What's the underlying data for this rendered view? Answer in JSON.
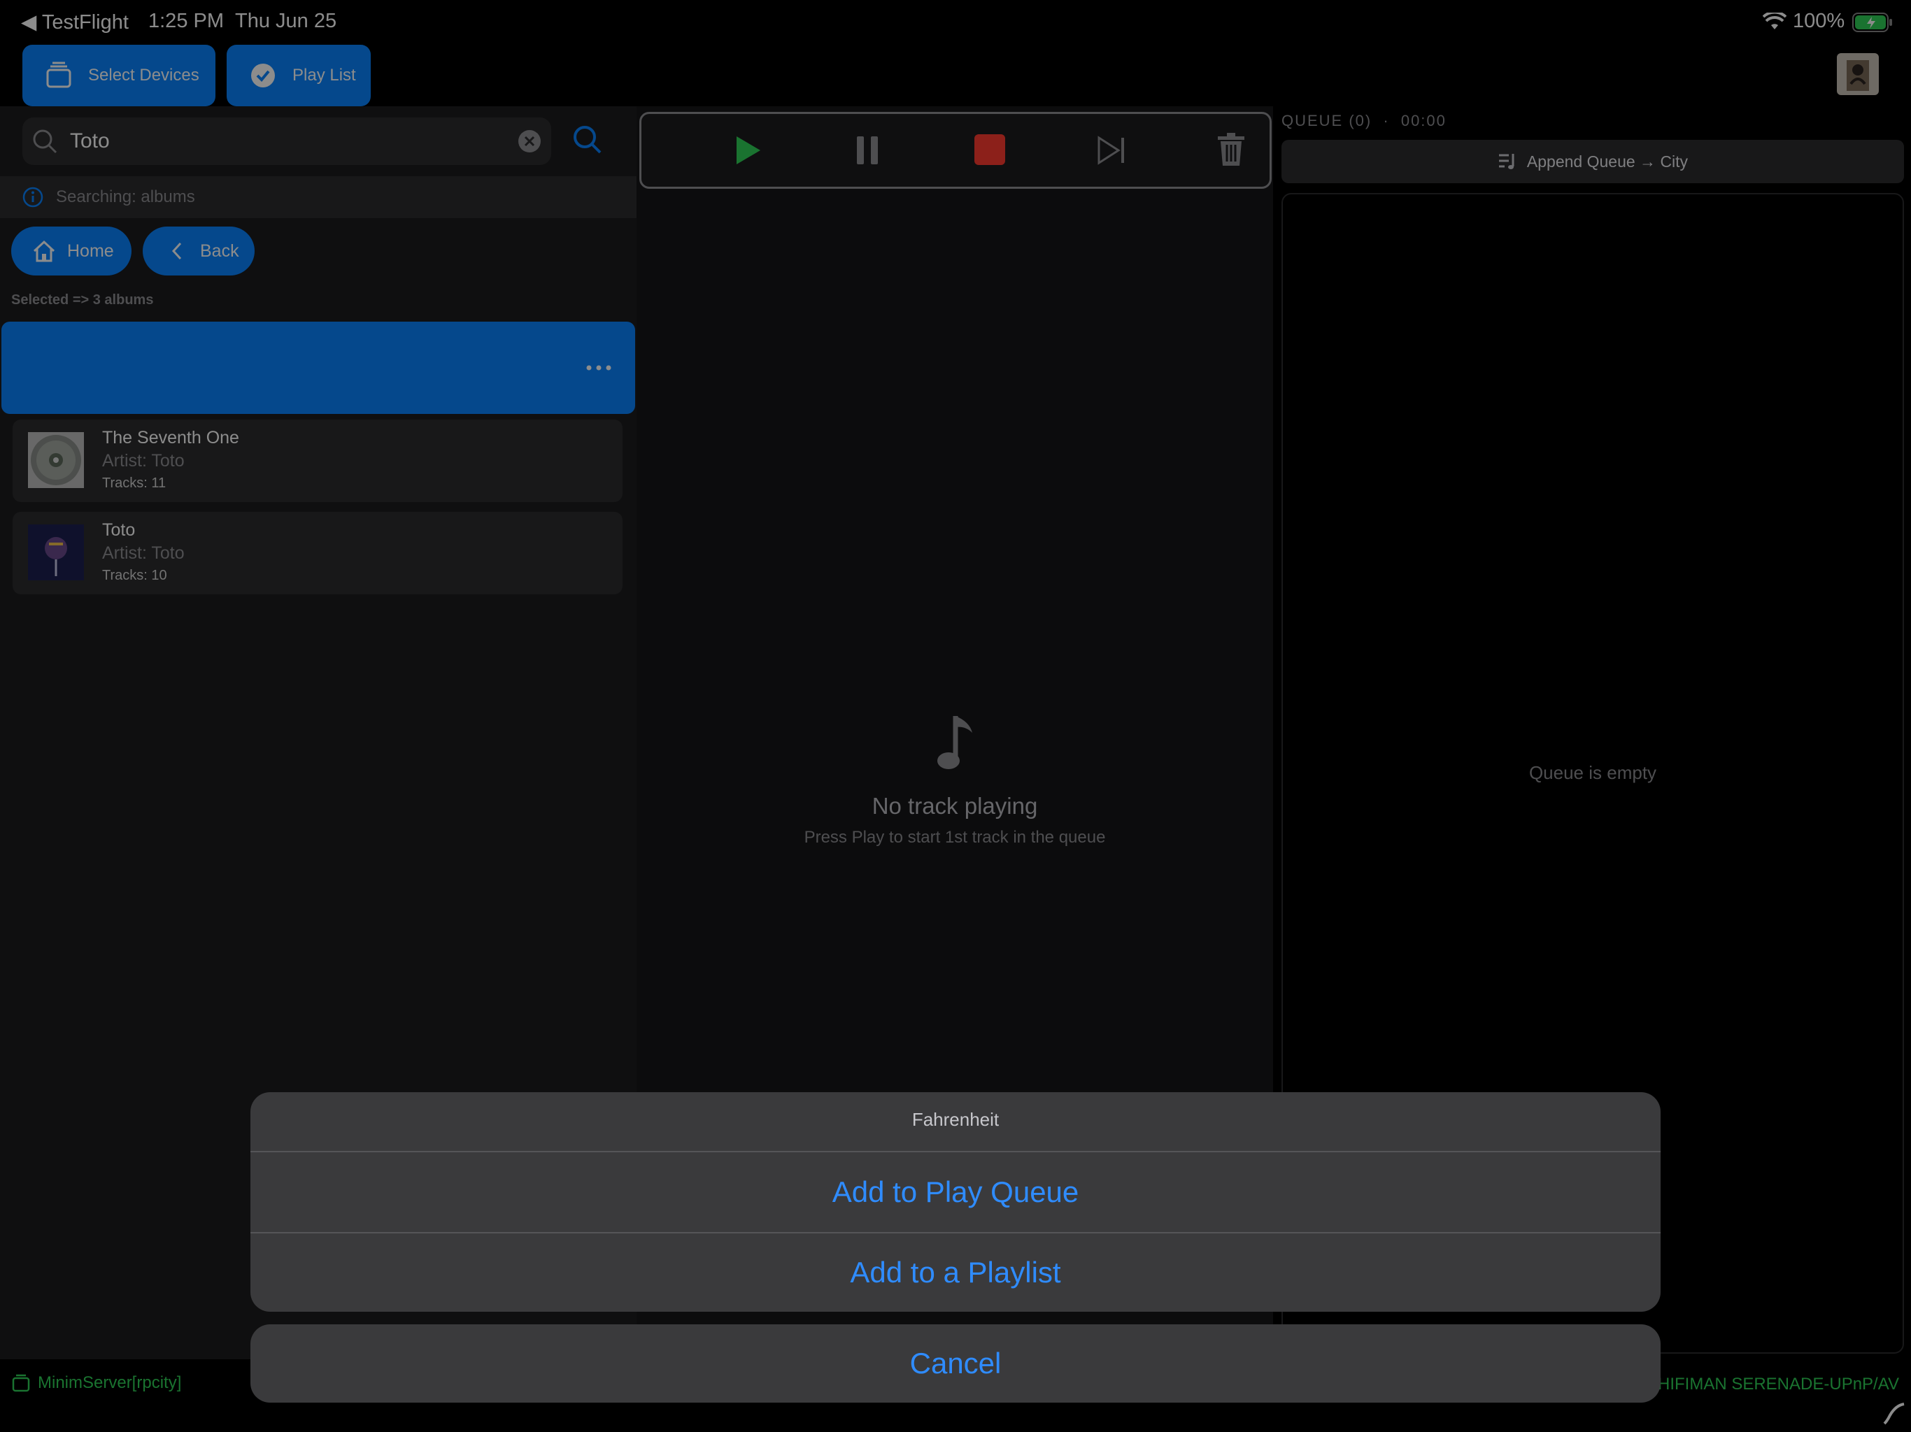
{
  "status_bar": {
    "back_app": "TestFlight",
    "time": "1:25 PM",
    "date": "Thu Jun 25",
    "battery": "100%"
  },
  "toolbar": {
    "select_devices": "Select Devices",
    "play_list": "Play List"
  },
  "search": {
    "value": "Toto",
    "info": "Searching: albums"
  },
  "nav": {
    "home": "Home",
    "back": "Back"
  },
  "selection_label": "Selected => 3 albums",
  "albums": [
    {
      "title": "",
      "artist": "",
      "tracks": "",
      "selected": true
    },
    {
      "title": "The Seventh One",
      "artist": "Artist: Toto",
      "tracks": "Tracks: 11"
    },
    {
      "title": "Toto",
      "artist": "Artist: Toto",
      "tracks": "Tracks: 10"
    }
  ],
  "player": {
    "no_track": "No track playing",
    "hint": "Press Play to start 1st track in the queue"
  },
  "queue": {
    "header": "QUEUE (0)",
    "separator": "·",
    "duration": "00:00",
    "append_button": "Append Queue → City",
    "empty": "Queue is empty"
  },
  "footer": {
    "server": "MinimServer[rpcity]",
    "renderer": "HIFIMAN SERENADE-UPnP/AV"
  },
  "action_sheet": {
    "title": "Fahrenheit",
    "add_queue": "Add to Play Queue",
    "add_playlist": "Add to a Playlist",
    "cancel": "Cancel"
  },
  "colors": {
    "accent": "#0a84ff",
    "play": "#30d158",
    "stop": "#ff3b30"
  }
}
